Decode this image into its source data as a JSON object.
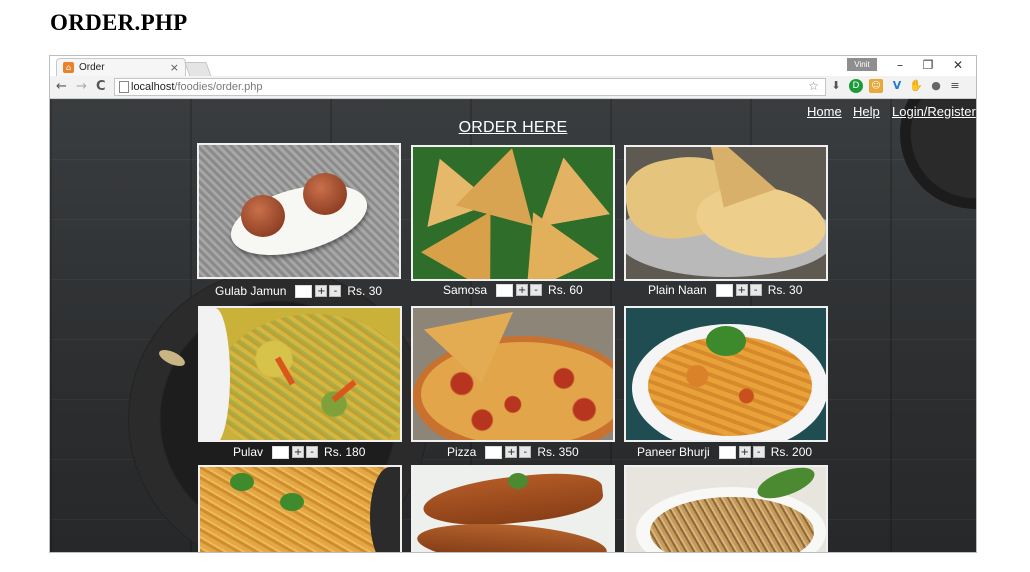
{
  "doc_title": "ORDER.PHP",
  "browser": {
    "tab_title": "Order",
    "tab_close": "×",
    "user_badge": "Vinit",
    "minimize": "–",
    "restore": "❐",
    "close": "✕",
    "back": "←",
    "forward": "→",
    "reload": "C",
    "url_host": "localhost",
    "url_path": "/foodies/order.php",
    "star": "☆",
    "menu": "≡"
  },
  "page": {
    "nav": [
      "Home",
      "Help",
      "Login/Register"
    ],
    "heading": "ORDER HERE",
    "items": [
      {
        "name": "Gulab Jamun",
        "price": "Rs. 30",
        "plus": "+",
        "minus": "-"
      },
      {
        "name": "Samosa",
        "price": "Rs. 60",
        "plus": "+",
        "minus": "-"
      },
      {
        "name": "Plain Naan",
        "price": "Rs. 30",
        "plus": "+",
        "minus": "-"
      },
      {
        "name": "Pulav",
        "price": "Rs. 180",
        "plus": "+",
        "minus": "-"
      },
      {
        "name": "Pizza",
        "price": "Rs. 350",
        "plus": "+",
        "minus": "-"
      },
      {
        "name": "Paneer Bhurji",
        "price": "Rs. 200",
        "plus": "+",
        "minus": "-"
      }
    ]
  }
}
